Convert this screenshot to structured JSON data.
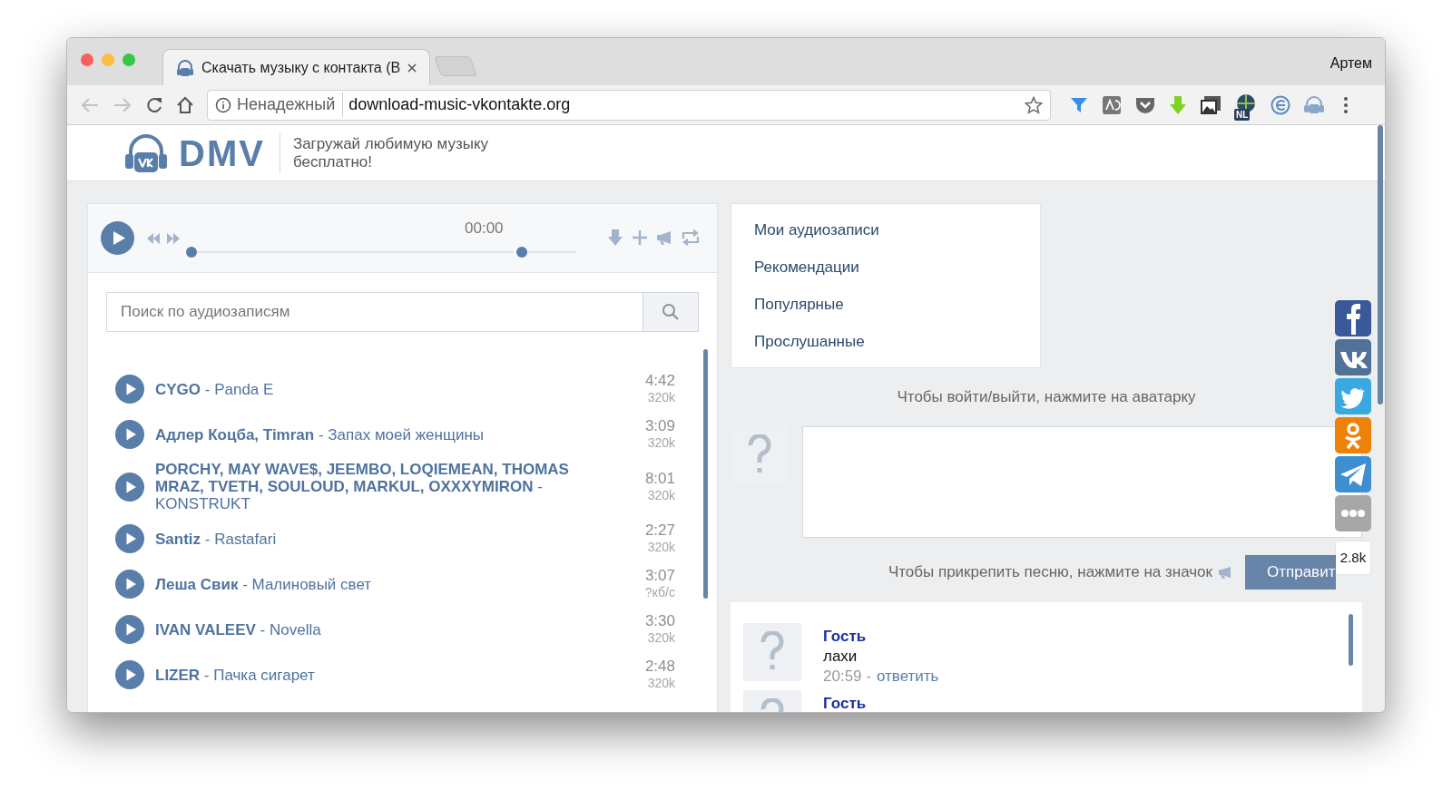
{
  "browser": {
    "tab_title": "Скачать музыку с контакта (В",
    "profile": "Артем",
    "security": "Ненадежный",
    "url": "download-music-vkontakte.org",
    "extension_badge": "NL"
  },
  "header": {
    "logo": "DMV",
    "tagline": "Загружай любимую музыку бесплатно!"
  },
  "player": {
    "time": "00:00",
    "progress": {
      "level": 0
    },
    "volume": {
      "level": 0
    },
    "search": {
      "placeholder": "Поиск по аудиозаписям"
    },
    "tracks": [
      {
        "name": "**CYGO** - Panda E",
        "duration": "4:42",
        "bitrate": "320k"
      },
      {
        "name": "**Адлер Коцба, Timran** - Запах моей женщины",
        "duration": "3:09",
        "bitrate": "320k"
      },
      {
        "name": "**PORCHY, MAY WAVE$, JEEMBO, LOQIEMEAN, THOMAS MRAZ, TVETH, SOULOUD, MARKUL, OXXXYMIRON** - KONSTRUKT",
        "duration": "8:01",
        "bitrate": "320k"
      },
      {
        "name": "**Santiz** - Rastafari",
        "duration": "2:27",
        "bitrate": "320k"
      },
      {
        "name": "**Леша Свик** - Малиновый свет",
        "duration": "3:07",
        "bitrate": "?кб/с"
      },
      {
        "name": "**IVAN VALEEV** - Novella",
        "duration": "3:30",
        "bitrate": "320k"
      },
      {
        "name": "**LIZER** - Пачка сигарет",
        "duration": "2:48",
        "bitrate": "320k"
      }
    ]
  },
  "menu": {
    "items": [
      "Мои аудиозаписи",
      "Рекомендации",
      "Популярные",
      "Прослушанные"
    ]
  },
  "chat": {
    "login_hint": "Чтобы войти/выйти, нажмите на аватарку",
    "attach_hint": "Чтобы прикрепить песню, нажмите на значок",
    "send_button": "Отправит",
    "comments": [
      {
        "author": "Гость",
        "text": "лахи",
        "time": "20:59 -",
        "reply": "ответить"
      },
      {
        "author": "Гость"
      }
    ]
  },
  "share": {
    "services": [
      {
        "kind": "facebook"
      },
      {
        "kind": "vk"
      },
      {
        "kind": "twitter"
      },
      {
        "kind": "odnoklassniki"
      },
      {
        "kind": "telegram"
      },
      {
        "kind": "more"
      }
    ],
    "count": "2.8k"
  }
}
